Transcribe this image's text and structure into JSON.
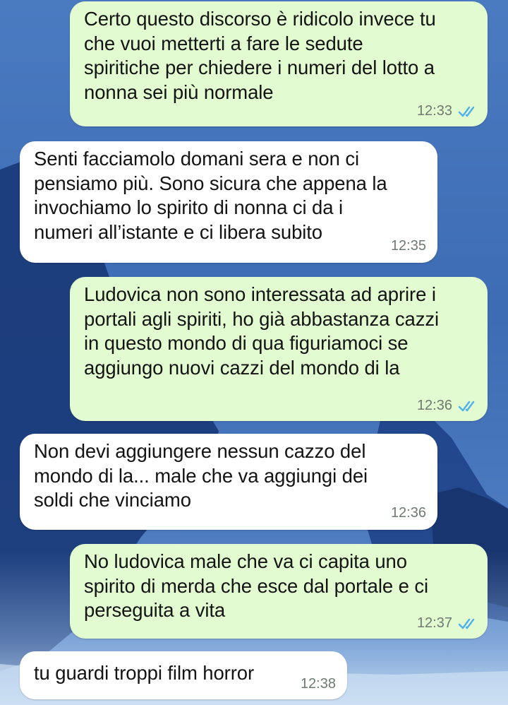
{
  "colors": {
    "outgoing_bubble": "#e2fbd1",
    "incoming_bubble": "#ffffff",
    "read_ticks": "#4fb1ec",
    "timestamp": "#6f7a72",
    "wallpaper_sky": "#3f6fb5",
    "wallpaper_mountains": "#16356f"
  },
  "messages": [
    {
      "direction": "outgoing",
      "text": "Certo questo discorso è ridicolo invece tu\nche vuoi metterti a fare le sedute\nspiritiche per chiedere i numeri del lotto a\nnonna sei più normale",
      "time": "12:33",
      "status_icon": "double-check-read-icon"
    },
    {
      "direction": "incoming",
      "text": "Senti facciamolo domani sera e non ci\npensiamo più. Sono sicura che appena la\ninvochiamo lo spirito di nonna ci da i\nnumeri all’istante e ci libera subito",
      "time": "12:35"
    },
    {
      "direction": "outgoing",
      "text": "Ludovica non sono interessata ad aprire i\nportali agli spiriti, ho già abbastanza cazzi\nin questo mondo di qua figuriamoci se\naggiungo nuovi cazzi del mondo di la",
      "time": "12:36",
      "status_icon": "double-check-read-icon"
    },
    {
      "direction": "incoming",
      "text": "Non devi aggiungere nessun cazzo del\nmondo di la... male che va aggiungi dei\nsoldi che vinciamo",
      "time": "12:36"
    },
    {
      "direction": "outgoing",
      "text": "No ludovica male che va ci capita uno\nspirito di merda che esce dal portale e ci\nperseguita a vita",
      "time": "12:37",
      "status_icon": "double-check-read-icon"
    },
    {
      "direction": "incoming",
      "text": "tu guardi troppi film horror",
      "time": "12:38"
    }
  ]
}
